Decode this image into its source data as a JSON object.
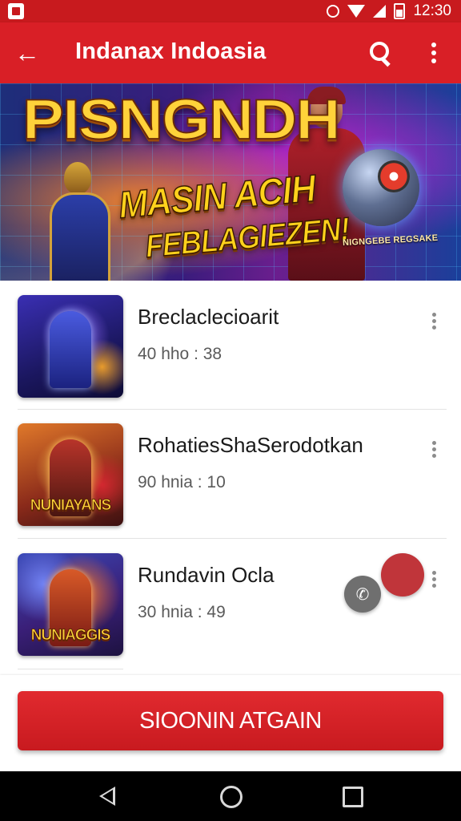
{
  "status_bar": {
    "time": "12:30",
    "icons": [
      "app-notification-icon",
      "alarm-icon",
      "wifi-icon",
      "signal-icon",
      "battery-icon"
    ]
  },
  "app_bar": {
    "title": "Indanax Indoasia",
    "icons": [
      "back-arrow-icon",
      "search-icon",
      "overflow-menu-icon"
    ],
    "color": "#d91f26"
  },
  "banner": {
    "title": "PISNGNDH",
    "line1": "MASIN ACIH",
    "line2": "FEBLAGIEZEN!",
    "tag": "NIGNGEBE REGSAKE"
  },
  "games": [
    {
      "title": "Breclaclecioarit",
      "meta": "40 hho : 38",
      "thumb_caption": ""
    },
    {
      "title": "RohatiesShaSerodotkan",
      "meta": "90 hnia : 10",
      "thumb_caption": "NUNIAYANS"
    },
    {
      "title": "Rundavin Ocla",
      "meta": "30 hnia : 49",
      "thumb_caption": "NUNIAGGIS"
    }
  ],
  "cta": {
    "label": "SIOONIN ATGAIN",
    "color": "#d91f26"
  },
  "nav_bar": {
    "icons": [
      "nav-back-icon",
      "nav-home-icon",
      "nav-recents-icon"
    ]
  }
}
